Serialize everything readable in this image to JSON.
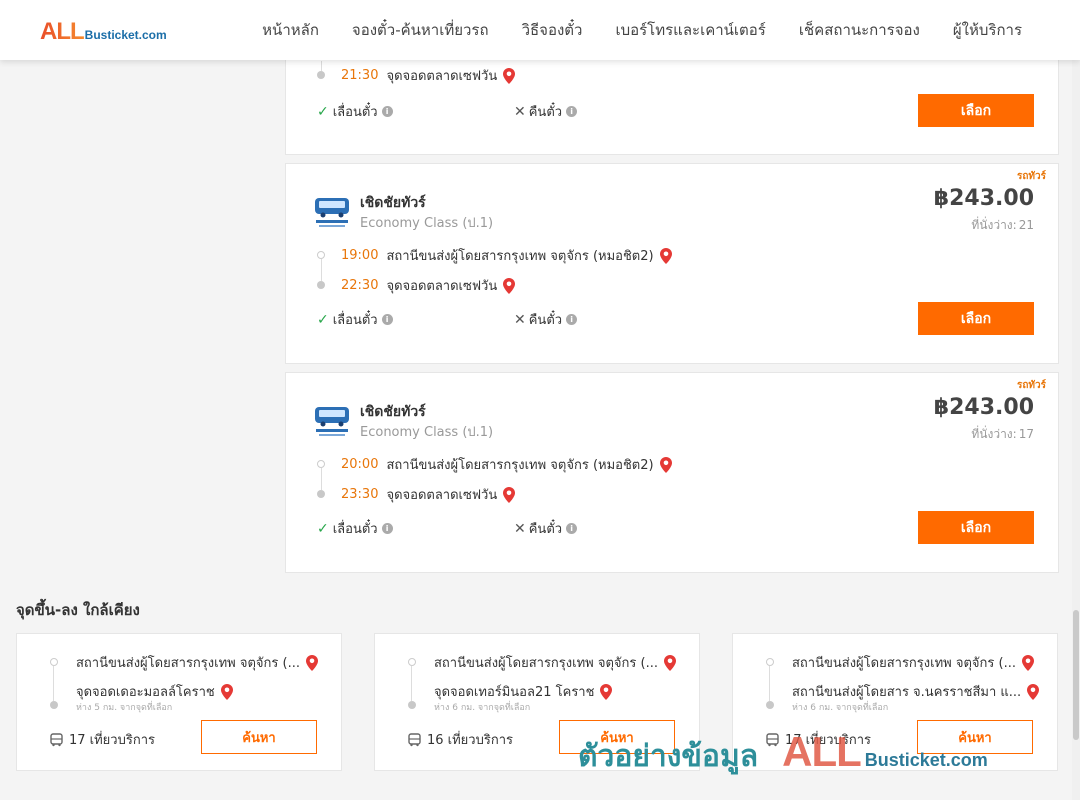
{
  "header": {
    "logo_all": "ALL",
    "logo_rest": "Busticket.com",
    "nav": [
      "หน้าหลัก",
      "จองตั๋ว-ค้นหาเที่ยวรถ",
      "วิธีจองตั๋ว",
      "เบอร์โทรและเคาน์เตอร์",
      "เช็คสถานะการจอง",
      "ผู้ให้บริการ"
    ]
  },
  "trips": [
    {
      "arrive_time": "21:30",
      "arrive_place": "จุดจอดตลาดเซฟวัน",
      "reschedule": "เลื่อนตั๋ว",
      "refund": "คืนตั๋ว",
      "select": "เลือก"
    },
    {
      "badge": "รถทัวร์",
      "operator": "เชิดชัยทัวร์",
      "bus_class": "Economy Class (ป.1)",
      "price": "฿243.00",
      "seats_label": "ที่นั่งว่าง:",
      "seats": "21",
      "depart_time": "19:00",
      "depart_place": "สถานีขนส่งผู้โดยสารกรุงเทพ จตุจักร (หมอชิต2)",
      "arrive_time": "22:30",
      "arrive_place": "จุดจอดตลาดเซฟวัน",
      "reschedule": "เลื่อนตั๋ว",
      "refund": "คืนตั๋ว",
      "select": "เลือก"
    },
    {
      "badge": "รถทัวร์",
      "operator": "เชิดชัยทัวร์",
      "bus_class": "Economy Class (ป.1)",
      "price": "฿243.00",
      "seats_label": "ที่นั่งว่าง:",
      "seats": "17",
      "depart_time": "20:00",
      "depart_place": "สถานีขนส่งผู้โดยสารกรุงเทพ จตุจักร (หมอชิต2)",
      "arrive_time": "23:30",
      "arrive_place": "จุดจอดตลาดเซฟวัน",
      "reschedule": "เลื่อนตั๋ว",
      "refund": "คืนตั๋ว",
      "select": "เลือก"
    }
  ],
  "nearby": {
    "title": "จุดขึ้น-ลง ใกล้เคียง",
    "cards": [
      {
        "from": "สถานีขนส่งผู้โดยสารกรุงเทพ จตุจักร (...",
        "to": "จุดจอดเดอะมอลล์โคราช",
        "distance": "ห่าง 5 กม. จากจุดที่เลือก",
        "trips": "17 เที่ยวบริการ",
        "button": "ค้นหา"
      },
      {
        "from": "สถานีขนส่งผู้โดยสารกรุงเทพ จตุจักร (...",
        "to": "จุดจอดเทอร์มินอล21 โคราช",
        "distance": "ห่าง 6 กม. จากจุดที่เลือก",
        "trips": "16 เที่ยวบริการ",
        "button": "ค้นหา"
      },
      {
        "from": "สถานีขนส่งผู้โดยสารกรุงเทพ จตุจักร (...",
        "to": "สถานีขนส่งผู้โดยสาร จ.นครราชสีมา แ...",
        "distance": "ห่าง 6 กม. จากจุดที่เลือก",
        "trips": "17 เที่ยวบริการ",
        "button": "ค้นหา"
      }
    ]
  },
  "watermark": {
    "thai": "ตัวอย่างข้อมูล",
    "all": "ALL",
    "rest": "Busticket.com"
  },
  "colors": {
    "accent": "#ff6a00",
    "time": "#e8760a",
    "check": "#27a64a",
    "pin": "#e53935"
  }
}
